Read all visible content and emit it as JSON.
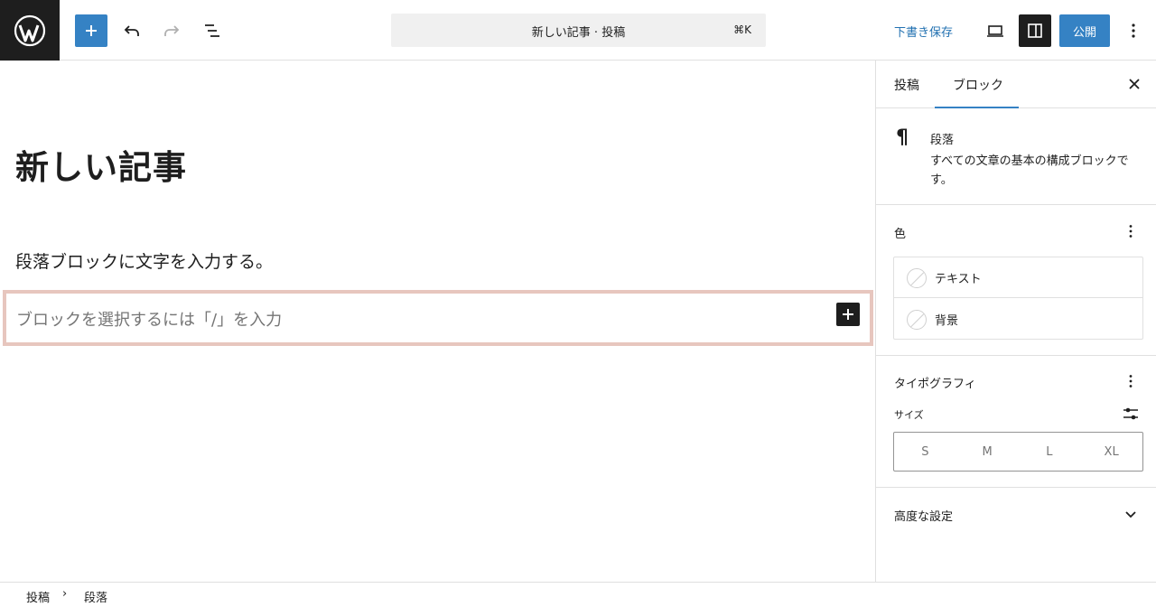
{
  "header": {
    "title": "新しい記事 · 投稿",
    "shortcut": "⌘K",
    "save_draft": "下書き保存",
    "publish": "公開"
  },
  "editor": {
    "post_title": "新しい記事",
    "paragraph": "段落ブロックに文字を入力する。",
    "empty_placeholder": "ブロックを選択するには「/」を入力"
  },
  "sidebar": {
    "tabs": [
      {
        "label": "投稿",
        "active": false
      },
      {
        "label": "ブロック",
        "active": true
      }
    ],
    "block_card": {
      "title": "段落",
      "description": "すべての文章の基本の構成ブロックです。"
    },
    "color": {
      "title": "色",
      "items": [
        {
          "label": "テキスト"
        },
        {
          "label": "背景"
        }
      ]
    },
    "typography": {
      "title": "タイポグラフィ",
      "size_label": "サイズ",
      "sizes": [
        "S",
        "M",
        "L",
        "XL"
      ]
    },
    "advanced": {
      "title": "高度な設定"
    }
  },
  "breadcrumb": {
    "items": [
      "投稿",
      "段落"
    ],
    "separator": "›"
  },
  "colors": {
    "accent": "#3582c4",
    "link": "#2271b1",
    "dark": "#1e1e1e",
    "block_highlight": "#e7c6be"
  }
}
